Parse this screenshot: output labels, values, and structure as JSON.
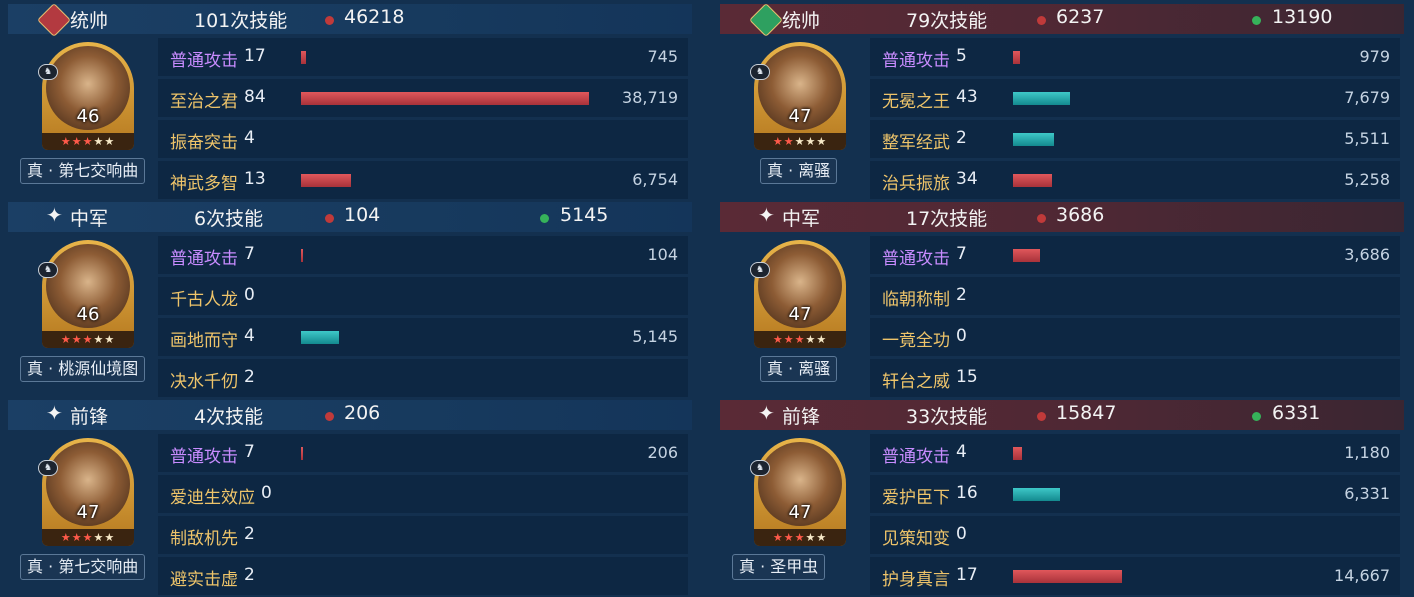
{
  "left": [
    {
      "role": "统帅",
      "casts": "101次技能",
      "red_total": "46218",
      "green_total": "",
      "header_icon": "sword-badge-icon",
      "level": "46",
      "stars_red": 3,
      "stars_total": 5,
      "tactic": "真 · 第七交响曲",
      "skills": [
        {
          "name": "普通攻击",
          "count": "17",
          "damage": "745",
          "bar_color": "red",
          "fraction": 0.019,
          "purple": true
        },
        {
          "name": "至治之君",
          "count": "84",
          "damage": "38,719",
          "bar_color": "red",
          "fraction": 1.0,
          "purple": false
        },
        {
          "name": "振奋突击",
          "count": "4",
          "damage": "",
          "bar_color": "red",
          "fraction": 0,
          "purple": false
        },
        {
          "name": "神武多智",
          "count": "13",
          "damage": "6,754",
          "bar_color": "red",
          "fraction": 0.174,
          "purple": false
        }
      ]
    },
    {
      "role": "中军",
      "casts": "6次技能",
      "red_total": "104",
      "green_total": "5145",
      "header_icon": "sparkle-icon",
      "level": "46",
      "stars_red": 3,
      "stars_total": 5,
      "tactic": "真 · 桃源仙境图",
      "skills": [
        {
          "name": "普通攻击",
          "count": "7",
          "damage": "104",
          "bar_color": "red",
          "fraction": 0.003,
          "purple": true
        },
        {
          "name": "千古人龙",
          "count": "0",
          "damage": "",
          "bar_color": "red",
          "fraction": 0,
          "purple": false
        },
        {
          "name": "画地而守",
          "count": "4",
          "damage": "5,145",
          "bar_color": "teal",
          "fraction": 0.133,
          "purple": false
        },
        {
          "name": "决水千仞",
          "count": "2",
          "damage": "",
          "bar_color": "red",
          "fraction": 0,
          "purple": false
        }
      ]
    },
    {
      "role": "前锋",
      "casts": "4次技能",
      "red_total": "206",
      "green_total": "",
      "header_icon": "sparkle-icon",
      "level": "47",
      "stars_red": 3,
      "stars_total": 5,
      "tactic": "真 · 第七交响曲",
      "skills": [
        {
          "name": "普通攻击",
          "count": "7",
          "damage": "206",
          "bar_color": "red",
          "fraction": 0.005,
          "purple": true
        },
        {
          "name": "爱迪生效应",
          "count": "0",
          "damage": "",
          "bar_color": "red",
          "fraction": 0,
          "purple": false
        },
        {
          "name": "制敌机先",
          "count": "2",
          "damage": "",
          "bar_color": "red",
          "fraction": 0,
          "purple": false
        },
        {
          "name": "避实击虚",
          "count": "2",
          "damage": "",
          "bar_color": "red",
          "fraction": 0,
          "purple": false
        }
      ]
    }
  ],
  "right": [
    {
      "role": "统帅",
      "casts": "79次技能",
      "red_total": "6237",
      "green_total": "13190",
      "header_icon": "heart-badge-icon",
      "level": "47",
      "stars_red": 2,
      "stars_total": 5,
      "tactic": "真 · 离骚",
      "skills": [
        {
          "name": "普通攻击",
          "count": "5",
          "damage": "979",
          "bar_color": "red",
          "fraction": 0.025,
          "purple": true
        },
        {
          "name": "无冕之王",
          "count": "43",
          "damage": "7,679",
          "bar_color": "teal",
          "fraction": 0.198,
          "purple": false
        },
        {
          "name": "整军经武",
          "count": "2",
          "damage": "5,511",
          "bar_color": "teal",
          "fraction": 0.142,
          "purple": false
        },
        {
          "name": "治兵振旅",
          "count": "34",
          "damage": "5,258",
          "bar_color": "red",
          "fraction": 0.136,
          "purple": false
        }
      ]
    },
    {
      "role": "中军",
      "casts": "17次技能",
      "red_total": "3686",
      "green_total": "",
      "header_icon": "sparkle-icon",
      "level": "47",
      "stars_red": 3,
      "stars_total": 5,
      "tactic": "真 · 离骚",
      "skills": [
        {
          "name": "普通攻击",
          "count": "7",
          "damage": "3,686",
          "bar_color": "red",
          "fraction": 0.095,
          "purple": true
        },
        {
          "name": "临朝称制",
          "count": "2",
          "damage": "",
          "bar_color": "red",
          "fraction": 0,
          "purple": false
        },
        {
          "name": "一竟全功",
          "count": "0",
          "damage": "",
          "bar_color": "red",
          "fraction": 0,
          "purple": false
        },
        {
          "name": "轩台之威",
          "count": "15",
          "damage": "",
          "bar_color": "red",
          "fraction": 0,
          "purple": false
        }
      ]
    },
    {
      "role": "前锋",
      "casts": "33次技能",
      "red_total": "15847",
      "green_total": "6331",
      "header_icon": "sparkle-icon",
      "level": "47",
      "stars_red": 3,
      "stars_total": 5,
      "tactic": "真 · 圣甲虫",
      "skills": [
        {
          "name": "普通攻击",
          "count": "4",
          "damage": "1,180",
          "bar_color": "red",
          "fraction": 0.03,
          "purple": true
        },
        {
          "name": "爱护臣下",
          "count": "16",
          "damage": "6,331",
          "bar_color": "teal",
          "fraction": 0.164,
          "purple": false
        },
        {
          "name": "见策知变",
          "count": "0",
          "damage": "",
          "bar_color": "red",
          "fraction": 0,
          "purple": false
        },
        {
          "name": "护身真言",
          "count": "17",
          "damage": "14,667",
          "bar_color": "red",
          "fraction": 0.379,
          "purple": false
        }
      ]
    }
  ]
}
